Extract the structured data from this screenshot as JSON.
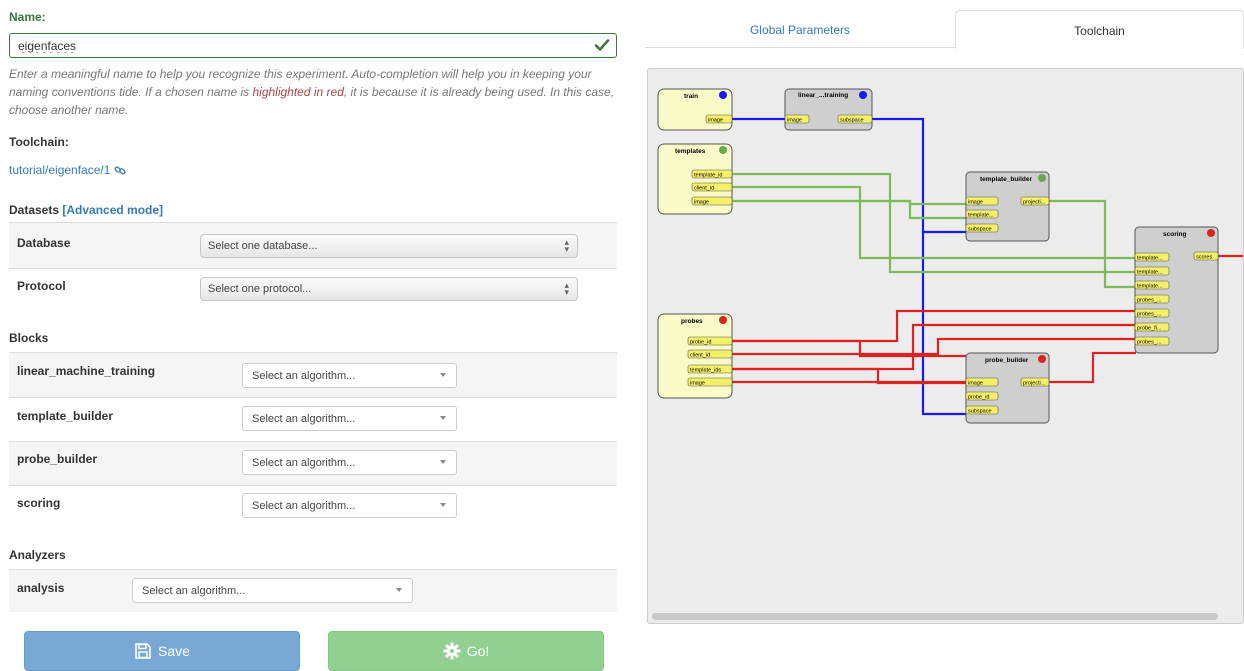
{
  "form": {
    "name_label": "Name:",
    "name_value": "eigenfaces",
    "help_part1": "Enter a meaningful name to help you recognize this experiment. Auto-completion will help you in keeping your naming conventions tide. If a chosen name is ",
    "help_highlight": "highlighted in red",
    "help_part2": ", it is because it is already being used. In this case, choose another name.",
    "toolchain_label": "Toolchain:",
    "toolchain_link": "tutorial/eigenface/1",
    "datasets_label": "Datasets",
    "advanced_link": "[Advanced mode]",
    "database_label": "Database",
    "database_placeholder": "Select one database...",
    "protocol_label": "Protocol",
    "protocol_placeholder": "Select one protocol...",
    "blocks_label": "Blocks",
    "blocks": [
      {
        "name": "linear_machine_training",
        "placeholder": "Select an algorithm..."
      },
      {
        "name": "template_builder",
        "placeholder": "Select an algorithm..."
      },
      {
        "name": "probe_builder",
        "placeholder": "Select an algorithm..."
      },
      {
        "name": "scoring",
        "placeholder": "Select an algorithm..."
      }
    ],
    "analyzers_label": "Analyzers",
    "analyzer": {
      "name": "analysis",
      "placeholder": "Select an algorithm..."
    },
    "save_label": "Save",
    "go_label": "Go!"
  },
  "tabs": {
    "global": "Global Parameters",
    "toolchain": "Toolchain"
  },
  "diagram": {
    "nodes": {
      "train": {
        "title": "train",
        "outputs": [
          "image"
        ]
      },
      "linear": {
        "title": "linear_...training",
        "inputs": [
          "image"
        ],
        "outputs": [
          "subspace"
        ]
      },
      "templates": {
        "title": "templates",
        "outputs": [
          "template_id",
          "client_id",
          "image"
        ]
      },
      "template_builder": {
        "title": "template_builder",
        "inputs": [
          "image",
          "template...",
          "subspace"
        ],
        "outputs": [
          "projecti..."
        ]
      },
      "scoring": {
        "title": "scoring",
        "inputs": [
          "template...",
          "template...",
          "template...",
          "probes_...",
          "probes_...",
          "probe_fi...",
          "probes_..."
        ],
        "outputs": [
          "scores"
        ]
      },
      "probes": {
        "title": "probes",
        "outputs": [
          "probe_id",
          "client_id",
          "template_ids",
          "image"
        ]
      },
      "probe_builder": {
        "title": "probe_builder",
        "inputs": [
          "image",
          "probe_id",
          "subspace"
        ],
        "outputs": [
          "projecti..."
        ]
      }
    }
  },
  "colors": {
    "success": "#3c763d",
    "link": "#337ab7",
    "error": "#a94442",
    "wire_blue": "#1a1aee",
    "wire_green": "#7cba5a",
    "wire_red": "#dd2222",
    "dataset_node": "#fafac8",
    "block_node": "#cfcfcf",
    "port": "#f5f06a"
  },
  "icons": {
    "check": "check-icon",
    "link": "link-icon",
    "save": "floppy-disk-icon",
    "go": "gear-icon"
  }
}
